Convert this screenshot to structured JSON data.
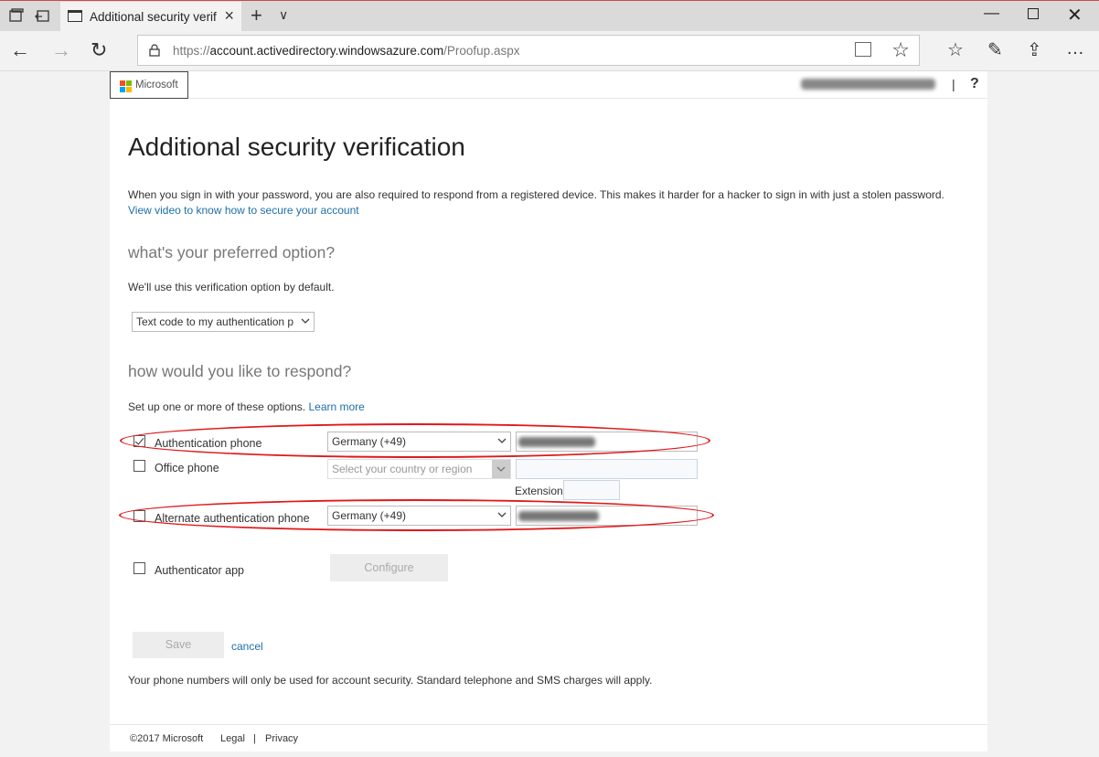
{
  "browser": {
    "tab_title": "Additional security verif",
    "url_prefix": "https://",
    "url_domain": "account.activedirectory.windowsazure.com",
    "url_path": "/Proofup.aspx"
  },
  "header": {
    "brand": "Microsoft",
    "help": "?",
    "separator": "|"
  },
  "main": {
    "title": "Additional security verification",
    "intro": "When you sign in with your password, you are also required to respond from a registered device. This makes it harder for a hacker to sign in with just a stolen password.",
    "video_link": "View video to know how to secure your account",
    "preferred_heading": "what's your preferred option?",
    "preferred_desc": "We'll use this verification option by default.",
    "preferred_value": "Text code to my authentication p",
    "respond_heading": "how would you like to respond?",
    "respond_desc": "Set up one or more of these options.",
    "learn_more": "Learn more",
    "rows": {
      "auth_phone": {
        "label": "Authentication phone",
        "country": "Germany (+49)"
      },
      "office_phone": {
        "label": "Office phone",
        "country_placeholder": "Select your country or region",
        "extension_label": "Extension"
      },
      "alt_phone": {
        "label": "Alternate authentication phone",
        "country": "Germany (+49)"
      },
      "app": {
        "label": "Authenticator app",
        "configure": "Configure"
      }
    },
    "save": "Save",
    "cancel": "cancel",
    "disclaimer": "Your phone numbers will only be used for account security. Standard telephone and SMS charges will apply."
  },
  "footer": {
    "copyright": "©2017 Microsoft",
    "legal": "Legal",
    "sep": "|",
    "privacy": "Privacy"
  },
  "colors": {
    "link": "#1e6ea7",
    "annotation": "#e0191b"
  }
}
